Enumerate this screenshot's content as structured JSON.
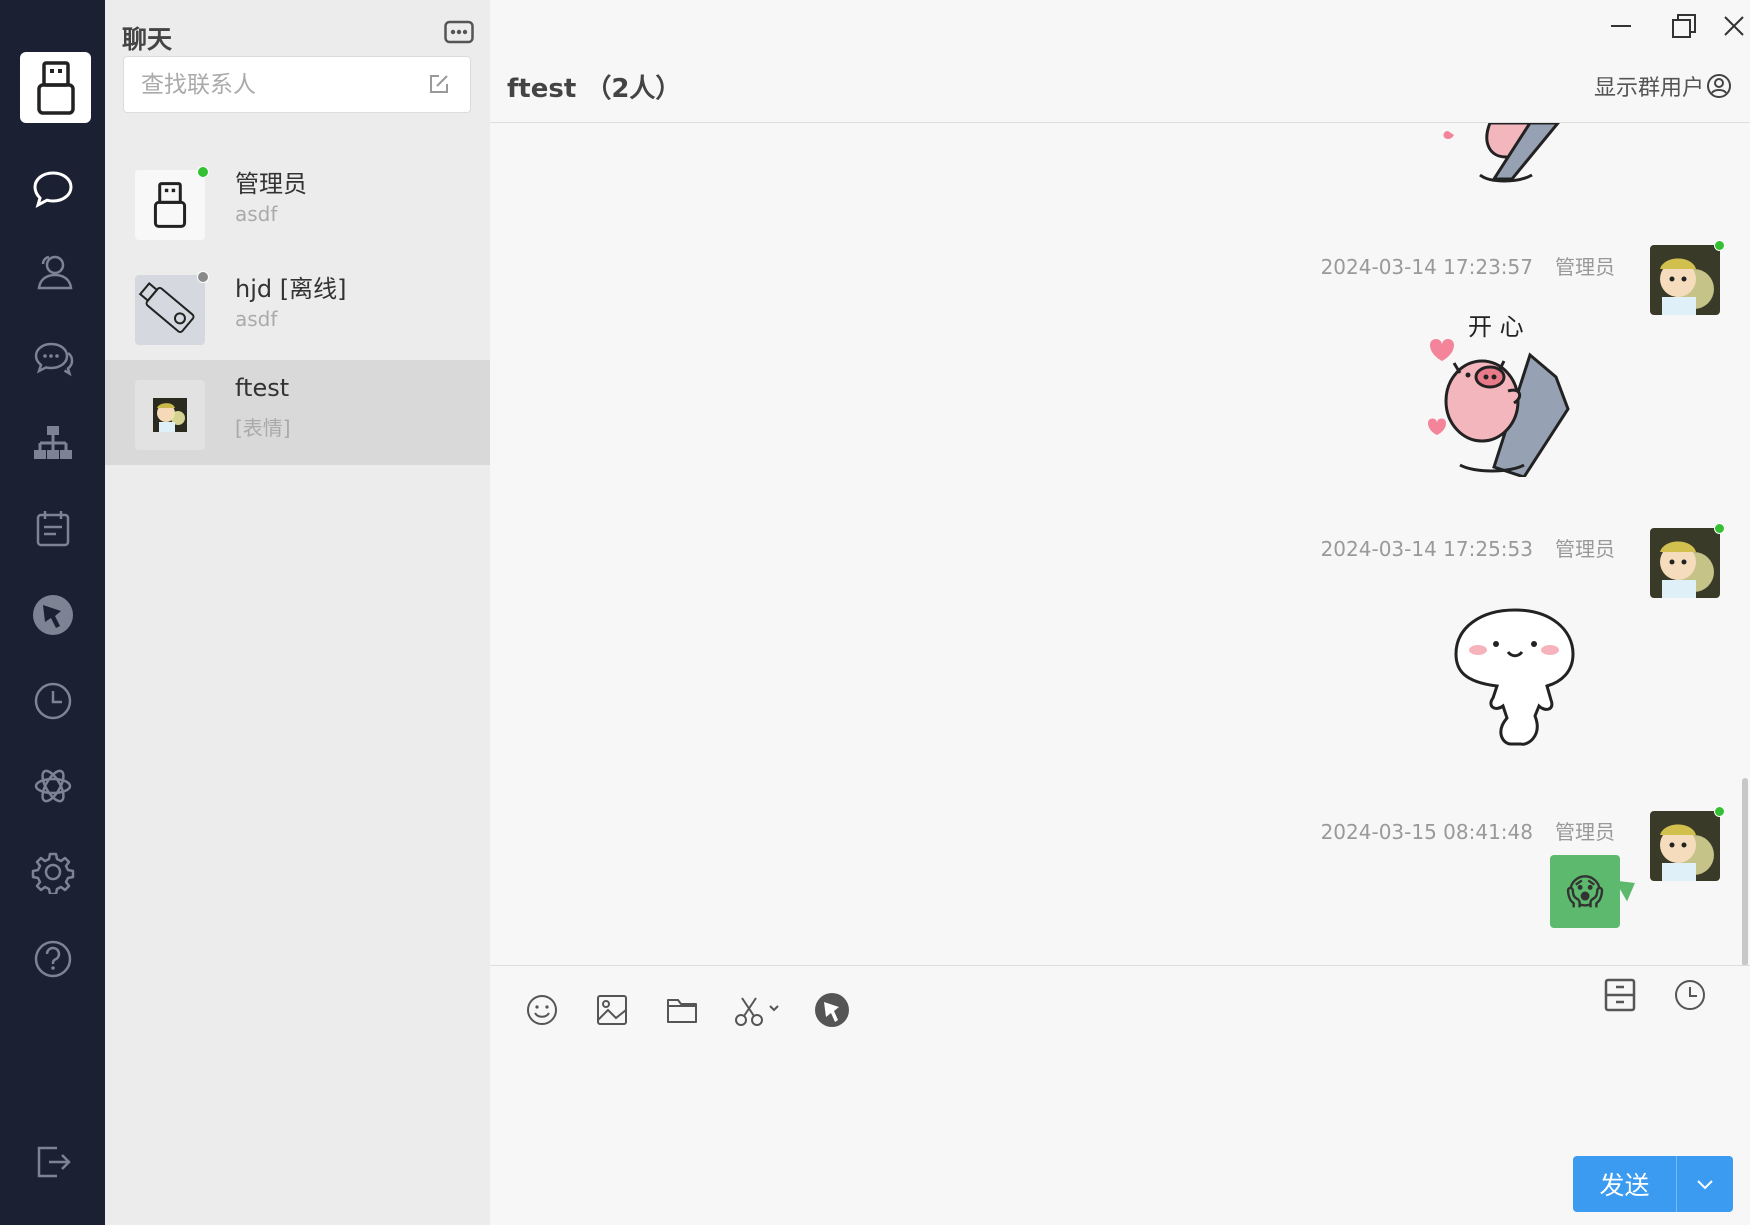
{
  "sidebar": {
    "items": [
      {
        "icon": "chat-bubble-icon",
        "active": true
      },
      {
        "icon": "contacts-icon"
      },
      {
        "icon": "group-chat-icon"
      },
      {
        "icon": "org-chart-icon"
      },
      {
        "icon": "calendar-note-icon"
      },
      {
        "icon": "pointer-logo-icon"
      },
      {
        "icon": "clock-icon"
      },
      {
        "icon": "ai-knot-icon"
      },
      {
        "icon": "gear-icon"
      },
      {
        "icon": "help-icon"
      }
    ],
    "logout_icon": "logout-icon"
  },
  "contacts_panel": {
    "title": "聊天",
    "search_placeholder": "查找联系人",
    "contacts": [
      {
        "name": "管理员",
        "subtitle": "asdf",
        "status": "online",
        "status_color": "#34c032"
      },
      {
        "name": "hjd [离线]",
        "subtitle": "asdf",
        "status": "offline",
        "status_color": "#8a8a8a"
      },
      {
        "name": "ftest",
        "subtitle": "[表情]",
        "active": true
      }
    ]
  },
  "chat": {
    "title": "ftest （2人）",
    "show_members_label": "显示群用户",
    "messages": [
      {
        "timestamp": "2024-03-14 17:23:57",
        "sender": "管理员",
        "type": "sticker",
        "sticker_text": "开 心"
      },
      {
        "timestamp": "2024-03-14 17:25:53",
        "sender": "管理员",
        "type": "sticker"
      },
      {
        "timestamp": "2024-03-15 08:41:48",
        "sender": "管理员",
        "type": "emoji",
        "content": "😱"
      }
    ]
  },
  "composer": {
    "send_label": "发送"
  },
  "colors": {
    "rail_bg": "#1b2033",
    "accent_blue": "#3a9bf0",
    "bubble_green": "#5cb96d",
    "online_green": "#34c032"
  }
}
